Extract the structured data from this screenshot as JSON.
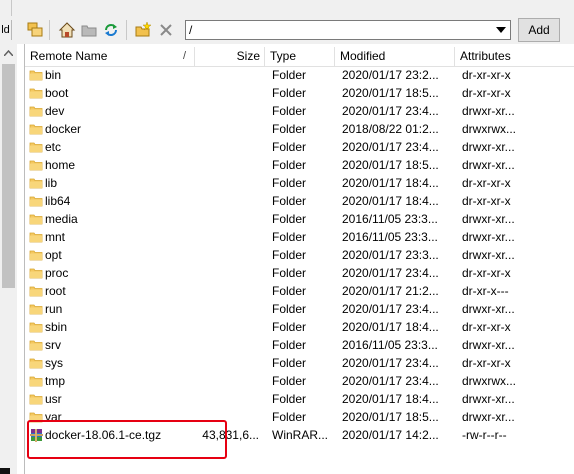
{
  "toolbar": {
    "partial_label": "ld",
    "path_value": "/",
    "add_label": "Add"
  },
  "columns": {
    "name": "Remote Name",
    "sort_indicator": "/",
    "size": "Size",
    "type": "Type",
    "modified": "Modified",
    "attributes": "Attributes"
  },
  "rows": [
    {
      "name": "bin",
      "size": "",
      "type": "Folder",
      "modified": "2020/01/17 23:2...",
      "attributes": "dr-xr-xr-x",
      "icon": "folder-icon"
    },
    {
      "name": "boot",
      "size": "",
      "type": "Folder",
      "modified": "2020/01/17 18:5...",
      "attributes": "dr-xr-xr-x",
      "icon": "folder-icon"
    },
    {
      "name": "dev",
      "size": "",
      "type": "Folder",
      "modified": "2020/01/17 23:4...",
      "attributes": "drwxr-xr...",
      "icon": "folder-icon"
    },
    {
      "name": "docker",
      "size": "",
      "type": "Folder",
      "modified": "2018/08/22 01:2...",
      "attributes": "drwxrwx...",
      "icon": "folder-icon"
    },
    {
      "name": "etc",
      "size": "",
      "type": "Folder",
      "modified": "2020/01/17 23:4...",
      "attributes": "drwxr-xr...",
      "icon": "folder-icon"
    },
    {
      "name": "home",
      "size": "",
      "type": "Folder",
      "modified": "2020/01/17 18:5...",
      "attributes": "drwxr-xr...",
      "icon": "folder-icon"
    },
    {
      "name": "lib",
      "size": "",
      "type": "Folder",
      "modified": "2020/01/17 18:4...",
      "attributes": "dr-xr-xr-x",
      "icon": "folder-icon"
    },
    {
      "name": "lib64",
      "size": "",
      "type": "Folder",
      "modified": "2020/01/17 18:4...",
      "attributes": "dr-xr-xr-x",
      "icon": "folder-icon"
    },
    {
      "name": "media",
      "size": "",
      "type": "Folder",
      "modified": "2016/11/05 23:3...",
      "attributes": "drwxr-xr...",
      "icon": "folder-icon"
    },
    {
      "name": "mnt",
      "size": "",
      "type": "Folder",
      "modified": "2016/11/05 23:3...",
      "attributes": "drwxr-xr...",
      "icon": "folder-icon"
    },
    {
      "name": "opt",
      "size": "",
      "type": "Folder",
      "modified": "2020/01/17 23:3...",
      "attributes": "drwxr-xr...",
      "icon": "folder-icon"
    },
    {
      "name": "proc",
      "size": "",
      "type": "Folder",
      "modified": "2020/01/17 23:4...",
      "attributes": "dr-xr-xr-x",
      "icon": "folder-icon"
    },
    {
      "name": "root",
      "size": "",
      "type": "Folder",
      "modified": "2020/01/17 21:2...",
      "attributes": "dr-xr-x---",
      "icon": "folder-icon"
    },
    {
      "name": "run",
      "size": "",
      "type": "Folder",
      "modified": "2020/01/17 23:4...",
      "attributes": "drwxr-xr...",
      "icon": "folder-icon"
    },
    {
      "name": "sbin",
      "size": "",
      "type": "Folder",
      "modified": "2020/01/17 18:4...",
      "attributes": "dr-xr-xr-x",
      "icon": "folder-icon"
    },
    {
      "name": "srv",
      "size": "",
      "type": "Folder",
      "modified": "2016/11/05 23:3...",
      "attributes": "drwxr-xr...",
      "icon": "folder-icon"
    },
    {
      "name": "sys",
      "size": "",
      "type": "Folder",
      "modified": "2020/01/17 23:4...",
      "attributes": "dr-xr-xr-x",
      "icon": "folder-icon"
    },
    {
      "name": "tmp",
      "size": "",
      "type": "Folder",
      "modified": "2020/01/17 23:4...",
      "attributes": "drwxrwx...",
      "icon": "folder-icon"
    },
    {
      "name": "usr",
      "size": "",
      "type": "Folder",
      "modified": "2020/01/17 18:4...",
      "attributes": "drwxr-xr...",
      "icon": "folder-icon"
    },
    {
      "name": "var",
      "size": "",
      "type": "Folder",
      "modified": "2020/01/17 18:5...",
      "attributes": "drwxr-xr...",
      "icon": "folder-icon"
    },
    {
      "name": "docker-18.06.1-ce.tgz",
      "size": "43,831,6...",
      "type": "WinRAR...",
      "modified": "2020/01/17 14:2...",
      "attributes": "-rw-r--r--",
      "icon": "winrar-archive-icon"
    }
  ],
  "colors": {
    "folder": "#f4c860",
    "highlight_border": "#e60012",
    "toolbar_bg": "#f0f0f0"
  }
}
